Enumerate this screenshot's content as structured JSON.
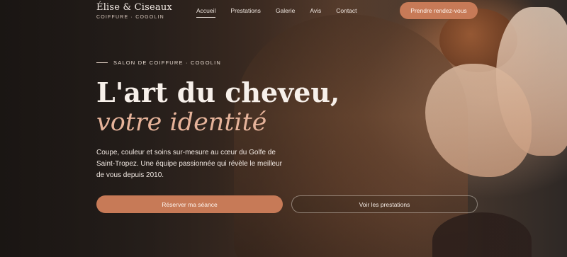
{
  "brand": {
    "name": "Élise & Ciseaux",
    "tagline": "COIFFURE · COGOLIN"
  },
  "nav": {
    "items": [
      {
        "label": "Accueil",
        "active": true
      },
      {
        "label": "Prestations",
        "active": false
      },
      {
        "label": "Galerie",
        "active": false
      },
      {
        "label": "Avis",
        "active": false
      },
      {
        "label": "Contact",
        "active": false
      }
    ],
    "cta_label": "Prendre rendez-vous"
  },
  "hero": {
    "eyebrow": "SALON DE COIFFURE · COGOLIN",
    "title_line1": "L'art du cheveu,",
    "title_line2": "votre identité",
    "description": "Coupe, couleur et soins sur-mesure au cœur du Golfe de Saint-Tropez. Une équipe passionnée qui révèle le meilleur de vous depuis 2010.",
    "primary_button": "Réserver ma séance",
    "secondary_button": "Voir les prestations"
  },
  "colors": {
    "accent": "#c77a57",
    "accent_text": "#e6b39a",
    "text_light": "#f7f0ea"
  }
}
